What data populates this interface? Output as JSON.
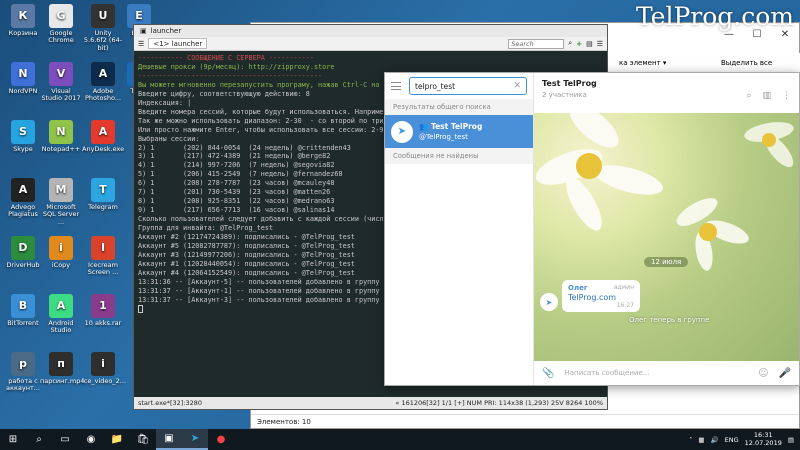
{
  "watermark": "TelProg.com",
  "desktop": {
    "icons": [
      {
        "label": "Корзина",
        "icon": "recycle-bin-icon",
        "color": "#5a7aa5"
      },
      {
        "label": "Google Chrome",
        "icon": "chrome-icon",
        "color": "#e8e8e8"
      },
      {
        "label": "Unity 5.6.6f2 (64-bit)",
        "icon": "unity-icon",
        "color": "#333333"
      },
      {
        "label": "Easy",
        "icon": "app-icon",
        "color": "#3a7abf"
      },
      {
        "label": "NordVPN",
        "icon": "nordvpn-icon",
        "color": "#3f6fd8"
      },
      {
        "label": "Visual Studio 2017",
        "icon": "visual-studio-icon",
        "color": "#7c4dbc"
      },
      {
        "label": "Adobe Photosho...",
        "icon": "photoshop-icon",
        "color": "#0d2b4a"
      },
      {
        "label": "Team",
        "icon": "teamviewer-icon",
        "color": "#1a6ab5"
      },
      {
        "label": "Skype",
        "icon": "skype-icon",
        "color": "#27a4e0"
      },
      {
        "label": "Notepad++",
        "icon": "notepadpp-icon",
        "color": "#8fc34a"
      },
      {
        "label": "AnyDesk.exe",
        "icon": "anydesk-icon",
        "color": "#e43a2e"
      },
      {
        "label": "Advego Plagiatus",
        "icon": "advego-icon",
        "color": "#222222"
      },
      {
        "label": "Microsoft SQL Server ...",
        "icon": "sql-server-icon",
        "color": "#b5b5b5"
      },
      {
        "label": "Telegram",
        "icon": "telegram-icon",
        "color": "#2ca5e0"
      },
      {
        "label": "DriverHub",
        "icon": "driverhub-icon",
        "color": "#2a8c3c"
      },
      {
        "label": "iCopy",
        "icon": "icopy-icon",
        "color": "#e08a1e"
      },
      {
        "label": "Icecream Screen ...",
        "icon": "icecream-icon",
        "color": "#d9432b"
      },
      {
        "label": "BitTorrent",
        "icon": "bittorrent-icon",
        "color": "#3b8fd6"
      },
      {
        "label": "Android Studio",
        "icon": "android-studio-icon",
        "color": "#3ddc84"
      },
      {
        "label": "10 akks.rar",
        "icon": "archive-icon",
        "color": "#8a3c8c"
      },
      {
        "label": "работа с аккаунт...",
        "icon": "folder-icon",
        "color": "#4b6a86"
      },
      {
        "label": "парсинг.mp4",
        "icon": "video-file-icon",
        "color": "#2e2e2e"
      },
      {
        "label": "ice_video_2...",
        "icon": "video-file-icon",
        "color": "#2e2e2e"
      }
    ]
  },
  "explorer": {
    "ribbon_item": "ка элемент ▾",
    "ribbon_action": "Выделить все",
    "status": "Элементов: 10"
  },
  "console": {
    "title": "launcher",
    "tab": "<1> launcher",
    "search_placeholder": "Search",
    "lines": [
      {
        "t": "----------- СООБЩЕНИЕ С СЕРВЕРА -----------",
        "c": "r"
      },
      {
        "t": "Дешевые прокси (9р/месяц): http://zipproxy.store",
        "c": "g"
      },
      {
        "t": "---------------------------------------------",
        "c": "r"
      },
      {
        "t": "",
        "c": ""
      },
      {
        "t": "Вы можете мгновенно перезапустить програму, нажав Ctrl-C на",
        "c": "g"
      },
      {
        "t": "Введите цифру, соответствующую действию: 8",
        "c": ""
      },
      {
        "t": "",
        "c": ""
      },
      {
        "t": "Индексация: |",
        "c": ""
      },
      {
        "t": "",
        "c": ""
      },
      {
        "t": "Введите номера сессий, которые будут использоваться. Наприме",
        "c": ""
      },
      {
        "t": "Так же можно использовать диапазон: 2-30  - со второй по трид",
        "c": ""
      },
      {
        "t": "Или просто нажмите Enter, чтобы использовать все сессии: 2-9",
        "c": ""
      },
      {
        "t": "",
        "c": ""
      },
      {
        "t": "Выбраны сессии:",
        "c": ""
      },
      {
        "t": "2) 1       (202) 844-0054  (24 недель) @crittenden43",
        "c": ""
      },
      {
        "t": "3) 1       (217) 472-4389  (21 недель) @berge82",
        "c": ""
      },
      {
        "t": "4) 1       (214) 997-7206  (7 недель) @segovia82",
        "c": ""
      },
      {
        "t": "5) 1       (206) 415-2549  (7 недель) @fernandez68",
        "c": ""
      },
      {
        "t": "6) 1       (208) 278-7787  (23 часов) @mcauley48",
        "c": ""
      },
      {
        "t": "7) 1       (201) 730-5439  (23 часов) @matten26",
        "c": ""
      },
      {
        "t": "8) 1       (208) 925-8351  (22 часов) @medrano63",
        "c": ""
      },
      {
        "t": "9) 1       (217) 656-7713  (16 часов) @salinas14",
        "c": ""
      },
      {
        "t": "",
        "c": ""
      },
      {
        "t": "Сколько пользователей следует добавить с каждой сессии (числ",
        "c": ""
      },
      {
        "t": "Группа для инвайта: @TelProg_test",
        "c": ""
      },
      {
        "t": "Аккаунт #2 (12174724389): подписались - @TelProg_test",
        "c": ""
      },
      {
        "t": "Аккаунт #5 (12082787787): подписались - @TelProg_test",
        "c": ""
      },
      {
        "t": "Аккаунт #3 (12149977206): подписались - @TelProg_test",
        "c": ""
      },
      {
        "t": "Аккаунт #1 (12028440054): подписались - @TelProg_test",
        "c": ""
      },
      {
        "t": "Аккаунт #4 (12064152549): подписались - @TelProg_test",
        "c": ""
      },
      {
        "t": "13:31:36 -- [Аккаунт-5] -- пользователей добавлено в группу",
        "c": ""
      },
      {
        "t": "13:31:37 -- [Аккаунт-1] -- пользователей добавлено в группу",
        "c": ""
      },
      {
        "t": "13:31:37 -- [Аккаунт-3] -- пользователей добавлено в группу",
        "c": ""
      }
    ],
    "status_left": "start.exe*[32]:3280",
    "status_right": "« 161206[32] 1/1 [+] NUM PRI: 114x38 (1,293) 25V 8264 100%"
  },
  "telegram": {
    "search_value": "telpro_test",
    "section_global": "Результаты общего поиска",
    "result_name": "Test TelProg",
    "result_handle": "@TelProg_test",
    "section_messages": "Сообщения не найдены",
    "chat_title": "Test TelProg",
    "chat_subtitle": "2 участника",
    "date_pill": "12 июля",
    "msg_from": "Олег",
    "msg_role": "админ",
    "msg_text": "TelProg.com",
    "msg_time": "16:27",
    "system_msg": "Олег теперь в группе",
    "composer_placeholder": "Написать сообщение...",
    "accent": "#4a90d9"
  },
  "taskbar": {
    "lang": "ENG",
    "time": "16:31",
    "date": "12.07.2019"
  }
}
